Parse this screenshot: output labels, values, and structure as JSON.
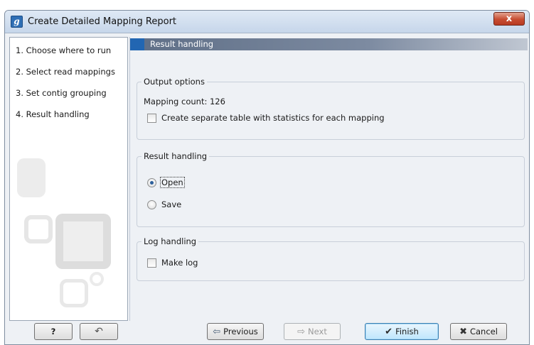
{
  "window": {
    "title": "Create Detailed Mapping Report",
    "app_icon": "g",
    "close_label": "x"
  },
  "steps": [
    {
      "label": "1.  Choose where to run"
    },
    {
      "label": "2.  Select read mappings"
    },
    {
      "label": "3.  Set contig grouping"
    },
    {
      "label": "4.  Result handling"
    }
  ],
  "section": {
    "title": "Result handling"
  },
  "output_options": {
    "title": "Output options",
    "mapping_count": "Mapping count: 126",
    "separate_table_label": "Create separate table with statistics for each mapping",
    "separate_table_checked": false
  },
  "result_handling": {
    "title": "Result handling",
    "open_label": "Open",
    "save_label": "Save",
    "selected": "Open"
  },
  "log_handling": {
    "title": "Log handling",
    "make_log_label": "Make log",
    "make_log_checked": false
  },
  "buttons": {
    "help": "?",
    "reset_icon": "undo-arrow-icon",
    "previous": "Previous",
    "next": "Next",
    "finish": "Finish",
    "cancel": "Cancel"
  }
}
